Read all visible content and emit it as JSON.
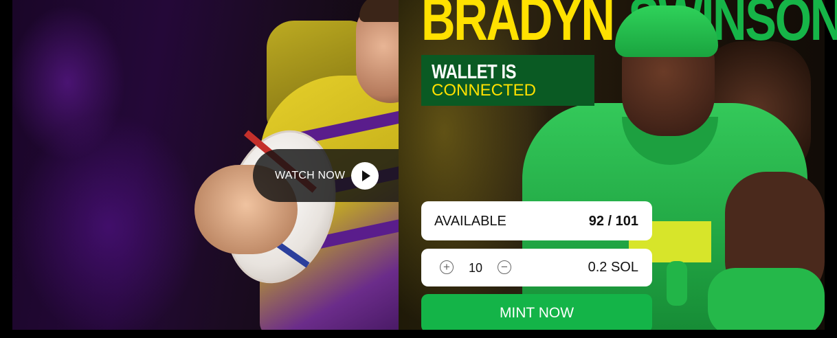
{
  "hero": {
    "first_name": "BRADYN",
    "last_name": "SWINSON"
  },
  "wallet": {
    "status_line1": "WALLET IS",
    "status_line2": "CONNECTED"
  },
  "video": {
    "watch_label": "WATCH NOW",
    "icon": "play-icon"
  },
  "mint": {
    "available_label": "AVAILABLE",
    "available_value": "92 / 101",
    "quantity": "10",
    "increase_icon": "plus-circle-icon",
    "decrease_icon": "minus-circle-icon",
    "price": "0.2 SOL",
    "button_label": "MINT NOW"
  },
  "colors": {
    "brand_yellow": "#ffe100",
    "brand_green": "#14b448",
    "badge_green": "#0a5a23"
  }
}
